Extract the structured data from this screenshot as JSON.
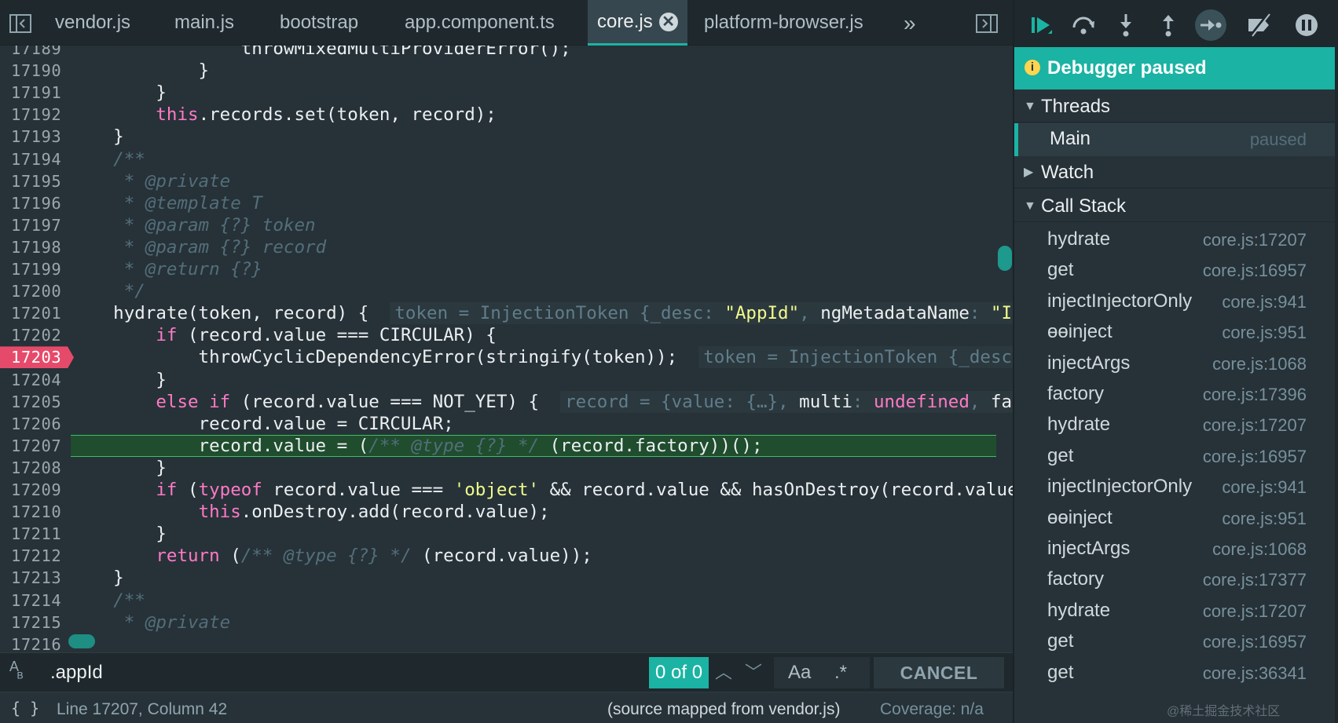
{
  "tabs": [
    {
      "label": "vendor.js",
      "active": false
    },
    {
      "label": "main.js",
      "active": false
    },
    {
      "label": "bootstrap",
      "active": false
    },
    {
      "label": "app.component.ts",
      "active": false
    },
    {
      "label": "core.js",
      "active": true
    },
    {
      "label": "platform-browser.js",
      "active": false
    }
  ],
  "tab_close_symbol": "✕",
  "tab_more_symbol": "»",
  "icons": {
    "navigator_toggle": "sidebar-left-icon",
    "debugger_toggle": "sidebar-right-icon",
    "resume": "resume-icon",
    "step_over": "step-over-icon",
    "step_into": "step-into-icon",
    "step_out": "step-out-icon",
    "step": "step-icon",
    "deactivate_breakpoints": "deactivate-breakpoints-icon",
    "pause_on_exceptions": "pause-icon"
  },
  "editor": {
    "breakpoint_line": "17203",
    "current_line": "17207",
    "lines": [
      {
        "num": "17189",
        "html": "                throwMixedMultiProviderError();"
      },
      {
        "num": "17190",
        "html": "            }"
      },
      {
        "num": "17191",
        "html": "        }"
      },
      {
        "num": "17192",
        "html": "        <span class=\"kw\">this</span>.records.set(token, record);"
      },
      {
        "num": "17193",
        "html": "    }"
      },
      {
        "num": "17194",
        "html": "    <span class=\"cm\">/**</span>"
      },
      {
        "num": "17195",
        "html": "     <span class=\"cm\">* @private</span>"
      },
      {
        "num": "17196",
        "html": "     <span class=\"cm\">* @template T</span>"
      },
      {
        "num": "17197",
        "html": "     <span class=\"cm\">* @param {?} token</span>"
      },
      {
        "num": "17198",
        "html": "     <span class=\"cm\">* @param {?} record</span>"
      },
      {
        "num": "17199",
        "html": "     <span class=\"cm\">* @return {?}</span>"
      },
      {
        "num": "17200",
        "html": "     <span class=\"cm\">*/</span>"
      },
      {
        "num": "17201",
        "html": "    hydrate(token, record) {  <span class=\"inline-box\"><span class=\"inline-val\">token = InjectionToken {_desc: </span><span class=\"str\">\"AppId\"</span><span class=\"inline-val\">, </span>ngMetadataName<span class=\"inline-val\">: </span><span class=\"str\">\"In</span></span>"
      },
      {
        "num": "17202",
        "html": "        <span class=\"kw\">if</span> (record.value === CIRCULAR) {"
      },
      {
        "num": "17203",
        "html": "            throwCyclicDependencyError(stringify(token));  <span class=\"inline-box\"><span class=\"inline-val\">token = InjectionToken {_desc:</span></span>"
      },
      {
        "num": "17204",
        "html": "        }"
      },
      {
        "num": "17205",
        "html": "        <span class=\"kw\">else if</span> (record.value === NOT_YET) {  <span class=\"inline-box\"><span class=\"inline-val\">record = {value: {…}, </span>multi<span class=\"inline-val\">: </span><span class=\"kw\">undefined</span><span class=\"inline-val\">, </span>fact</span>"
      },
      {
        "num": "17206",
        "html": "            record.value = CIRCULAR;"
      },
      {
        "num": "17207",
        "html": "            record.value = (<span class=\"cm\">/** @type {?} */</span> (record.factory))();"
      },
      {
        "num": "17208",
        "html": "        }"
      },
      {
        "num": "17209",
        "html": "        <span class=\"kw\">if</span> (<span class=\"kw\">typeof</span> record.value === <span class=\"str\">'object'</span> &amp;&amp; record.value &amp;&amp; hasOnDestroy(record.value))"
      },
      {
        "num": "17210",
        "html": "            <span class=\"kw\">this</span>.onDestroy.add(record.value);"
      },
      {
        "num": "17211",
        "html": "        }"
      },
      {
        "num": "17212",
        "html": "        <span class=\"kw\">return</span> (<span class=\"cm\">/** @type {?} */</span> (record.value));"
      },
      {
        "num": "17213",
        "html": "    }"
      },
      {
        "num": "17214",
        "html": "    <span class=\"cm\">/**</span>"
      },
      {
        "num": "17215",
        "html": "     <span class=\"cm\">* @private</span>"
      },
      {
        "num": "17216",
        "html": ""
      }
    ]
  },
  "search": {
    "value": ".appId",
    "count": "0 of 0",
    "match_case_label": "Aa",
    "regex_label": ".*",
    "cancel_label": "CANCEL"
  },
  "status": {
    "braces": "{ }",
    "position": "Line 17207, Column 42",
    "source": "(source mapped from vendor.js)",
    "coverage": "Coverage: n/a"
  },
  "debugger": {
    "banner": "Debugger paused",
    "threads_label": "Threads",
    "thread": {
      "name": "Main",
      "status": "paused"
    },
    "watch_label": "Watch",
    "callstack_label": "Call Stack",
    "frames": [
      {
        "fn": "hydrate",
        "loc": "core.js:17207"
      },
      {
        "fn": "get",
        "loc": "core.js:16957"
      },
      {
        "fn": "injectInjectorOnly",
        "loc": "core.js:941"
      },
      {
        "fn": "ɵɵinject",
        "loc": "core.js:951"
      },
      {
        "fn": "injectArgs",
        "loc": "core.js:1068"
      },
      {
        "fn": "factory",
        "loc": "core.js:17396"
      },
      {
        "fn": "hydrate",
        "loc": "core.js:17207"
      },
      {
        "fn": "get",
        "loc": "core.js:16957"
      },
      {
        "fn": "injectInjectorOnly",
        "loc": "core.js:941"
      },
      {
        "fn": "ɵɵinject",
        "loc": "core.js:951"
      },
      {
        "fn": "injectArgs",
        "loc": "core.js:1068"
      },
      {
        "fn": "factory",
        "loc": "core.js:17377"
      },
      {
        "fn": "hydrate",
        "loc": "core.js:17207"
      },
      {
        "fn": "get",
        "loc": "core.js:16957"
      },
      {
        "fn": "get",
        "loc": "core.js:36341"
      }
    ]
  },
  "watermark": "@稀土掘金技术社区",
  "colors": {
    "accent": "#1bb3a3",
    "breakpoint": "#e64a6b",
    "current_line": "#1f4d2e",
    "keyword": "#ff79c6",
    "string": "#f1fa8c"
  }
}
